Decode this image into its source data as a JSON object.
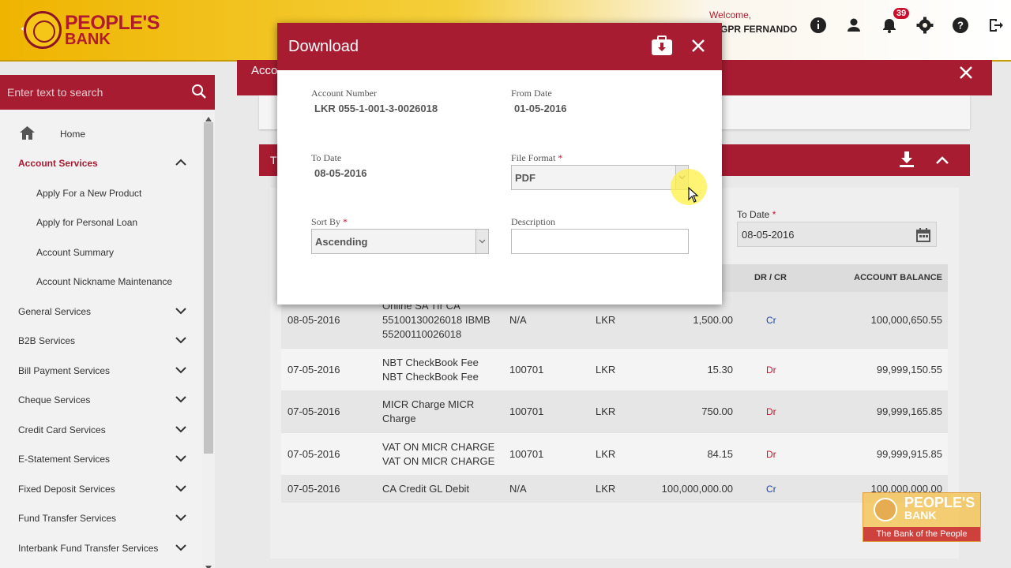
{
  "header": {
    "logo_line1": "PEOPLE'S",
    "logo_line2": "BANK",
    "welcome": "Welcome,",
    "user_name": "R GPR FERNANDO",
    "notification_count": "39"
  },
  "sidebar": {
    "search_placeholder": "Enter text to search",
    "items": [
      {
        "label": "Home"
      },
      {
        "label": "Account Services"
      },
      {
        "label": "Apply For a New Product"
      },
      {
        "label": "Apply for Personal Loan"
      },
      {
        "label": "Account Summary"
      },
      {
        "label": "Account Nickname Maintenance"
      },
      {
        "label": "General Services"
      },
      {
        "label": "B2B Services"
      },
      {
        "label": "Bill Payment Services"
      },
      {
        "label": "Cheque Services"
      },
      {
        "label": "Credit Card Services"
      },
      {
        "label": "E-Statement Services"
      },
      {
        "label": "Fixed Deposit Services"
      },
      {
        "label": "Fund Transfer Services"
      },
      {
        "label": "Interbank Fund Transfer Services"
      }
    ]
  },
  "main": {
    "header_title": "Acco",
    "section_title": "T",
    "to_date_label": "To Date",
    "to_date_value": "08-05-2016"
  },
  "table": {
    "headers": {
      "amount_tail": "R)",
      "drcr": "DR / CR",
      "balance": "ACCOUNT BALANCE"
    },
    "rows": [
      {
        "date": "08-05-2016",
        "desc": [
          "Online SA Tfr CA",
          "55100130026018 IBMB",
          "55200110026018"
        ],
        "ref": "N/A",
        "cur": "LKR",
        "amount": "1,500.00",
        "drcr": "Cr",
        "balance": "100,000,650.55"
      },
      {
        "date": "07-05-2016",
        "desc": [
          "NBT CheckBook Fee",
          "NBT CheckBook Fee"
        ],
        "ref": "100701",
        "cur": "LKR",
        "amount": "15.30",
        "drcr": "Dr",
        "balance": "99,999,150.55"
      },
      {
        "date": "07-05-2016",
        "desc": [
          "MICR Charge MICR",
          "Charge"
        ],
        "ref": "100701",
        "cur": "LKR",
        "amount": "750.00",
        "drcr": "Dr",
        "balance": "99,999,165.85"
      },
      {
        "date": "07-05-2016",
        "desc": [
          "VAT ON MICR CHARGE",
          "VAT ON MICR CHARGE"
        ],
        "ref": "100701",
        "cur": "LKR",
        "amount": "84.15",
        "drcr": "Dr",
        "balance": "99,999,915.85"
      },
      {
        "date": "07-05-2016",
        "desc": [
          "CA Credit GL Debit"
        ],
        "ref": "N/A",
        "cur": "LKR",
        "amount": "100,000,000.00",
        "drcr": "Cr",
        "balance": "100,000,000.00"
      }
    ]
  },
  "modal": {
    "title": "Download",
    "account_number_label": "Account Number",
    "account_number_value": "LKR 055-1-001-3-0026018",
    "from_date_label": "From Date",
    "from_date_value": "01-05-2016",
    "to_date_label": "To Date",
    "to_date_value": "08-05-2016",
    "file_format_label": "File Format",
    "file_format_value": "PDF",
    "sort_by_label": "Sort By",
    "sort_by_value": "Ascending",
    "description_label": "Description",
    "required_mark": "*"
  },
  "watermark": {
    "line1": "PEOPLE'S",
    "line2": "BANK",
    "tagline": "The Bank of the People"
  },
  "colors": {
    "primary": "#a81c32",
    "accent": "#f5c518",
    "credit": "#1a3fb0",
    "debit": "#c8102e"
  }
}
